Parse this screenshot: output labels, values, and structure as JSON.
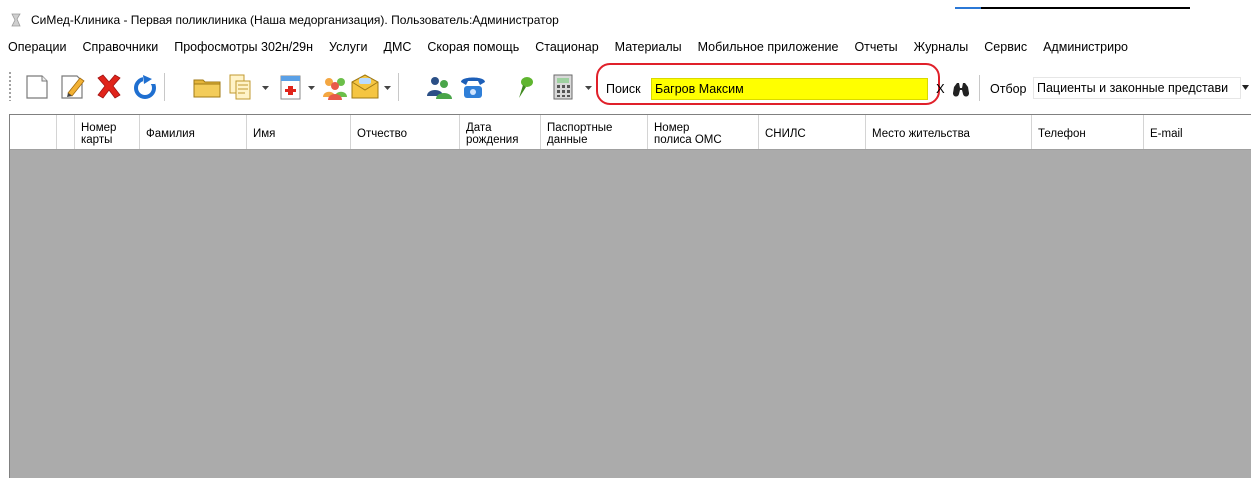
{
  "window": {
    "title": "СиМед-Клиника - Первая поликлиника (Наша медорганизация). Пользователь:Администратор"
  },
  "menu": [
    "Операции",
    "Справочники",
    "Профосмотры 302н/29н",
    "Услуги",
    "ДМС",
    "Скорая помощь",
    "Стационар",
    "Материалы",
    "Мобильное приложение",
    "Отчеты",
    "Журналы",
    "Сервис",
    "Администриро"
  ],
  "toolbar": {
    "icons": [
      "new-document-icon",
      "edit-pencil-icon",
      "delete-x-icon",
      "refresh-icon",
      "folder-icon",
      "copy-pages-icon",
      "medical-card-icon",
      "users-group-icon",
      "sms-envelope-icon",
      "people-icon",
      "phone-icon",
      "pin-icon",
      "calculator-icon"
    ],
    "search_label": "Поиск",
    "search_value": "Багров Максим",
    "clear_label": "X",
    "filter_label": "Отбор",
    "filter_value": "Пациенты и законные представи",
    "highlight_color": "#e0202a",
    "search_bg": "#ffff00"
  },
  "grid": {
    "columns": [
      "",
      "",
      "Номер\nкарты",
      "Фамилия",
      "Имя",
      "Отчество",
      "Дата\nрождения",
      "Паспортные\nданные",
      "Номер\nполиса ОМС",
      "СНИЛС",
      "Место жительства",
      "Телефон",
      "E-mail"
    ],
    "rows": [],
    "empty_bg": "#ababab"
  }
}
